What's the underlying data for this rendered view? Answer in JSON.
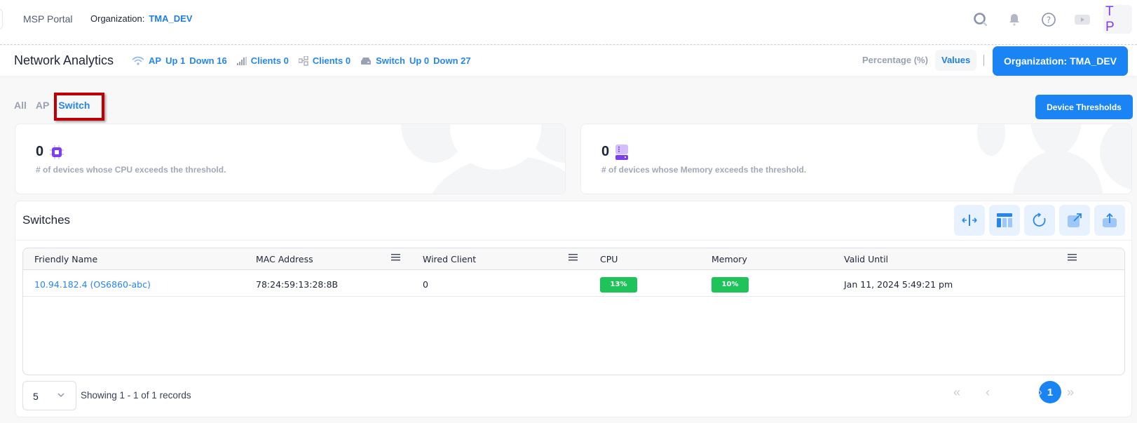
{
  "topbar": {
    "brand": "MSP Portal",
    "org_label": "Organization:",
    "org_value": "TMA_DEV",
    "icons": [
      "search-icon",
      "bell-icon",
      "help-icon",
      "video-icon"
    ],
    "avatar_initials": "T P"
  },
  "subheader": {
    "title": "Network Analytics",
    "stats": {
      "ap_label": "AP",
      "ap_up": "Up 1",
      "ap_down": "Down 16",
      "wireless_clients": "Clients 0",
      "wired_clients": "Clients 0",
      "switch_label": "Switch",
      "switch_up": "Up 0",
      "switch_down": "Down 27"
    },
    "view_options": [
      "Percentage (%)",
      "Values"
    ],
    "selected_view": "Values",
    "org_button": "Organization: TMA_DEV"
  },
  "tabs": [
    {
      "label": "All",
      "active": false
    },
    {
      "label": "AP",
      "active": false
    },
    {
      "label": "Switch",
      "active": true
    }
  ],
  "device_thresholds_button": "Device Thresholds",
  "kpis": {
    "cpu": {
      "value": "0",
      "description": "# of devices whose CPU exceeds the threshold."
    },
    "memory": {
      "value": "0",
      "description": "# of devices whose Memory exceeds the threshold."
    }
  },
  "colors": {
    "accent": "#1a84f5",
    "link": "#2686ef",
    "ok_badge": "#1ec35a",
    "icon_purple": "#7d3ef2",
    "highlight_box": "#c00000"
  },
  "switches_panel": {
    "title": "Switches",
    "toolbar": [
      "column-resize-icon",
      "column-layout-icon",
      "refresh-icon",
      "external-link-icon",
      "export-icon"
    ],
    "columns": [
      "Friendly Name",
      "MAC Address",
      "Wired Client",
      "CPU",
      "Memory",
      "Valid Until"
    ],
    "rows": [
      {
        "friendly_name": "10.94.182.4 (OS6860-abc)",
        "mac_address": "78:24:59:13:28:8B",
        "wired_client": "0",
        "cpu": "13%",
        "memory": "10%",
        "valid_until": "Jan 11, 2024 5:49:21 pm"
      }
    ],
    "pagination": {
      "page_size": "5",
      "records_info": "Showing 1 - 1 of 1 records",
      "current_page": "1",
      "first": "«",
      "prev": "‹",
      "next": "›",
      "last": "»"
    }
  }
}
